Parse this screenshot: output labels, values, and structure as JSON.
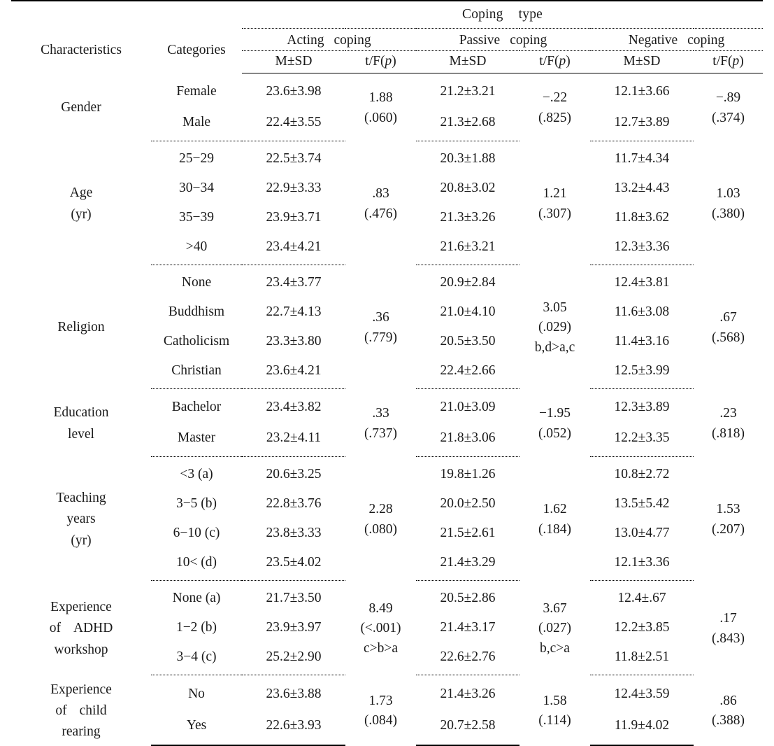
{
  "table": {
    "header": {
      "group_title": "Coping type",
      "stub_characteristics": "Characteristics",
      "stub_categories": "Categories",
      "groups": [
        {
          "name": "Acting coping",
          "word1": "Acting",
          "word2": "coping"
        },
        {
          "name": "Passive coping",
          "word1": "Passive",
          "word2": "coping"
        },
        {
          "name": "Negative coping",
          "word1": "Negative",
          "word2": "coping"
        }
      ],
      "sub_msd": "M±SD",
      "sub_tf_prefix": "t/F(",
      "sub_tf_italic": "p",
      "sub_tf_suffix": ")"
    },
    "sections": [
      {
        "characteristic": "Gender",
        "characteristic_lines": [
          "Gender"
        ],
        "categories": [
          "Female",
          "Male"
        ],
        "acting_msd": [
          "23.6±3.98",
          "22.4±3.55"
        ],
        "acting_tf": [
          "1.88",
          "(.060)"
        ],
        "passive_msd": [
          "21.2±3.21",
          "21.3±2.68"
        ],
        "passive_tf": [
          "−.22",
          "(.825)"
        ],
        "negative_msd": [
          "12.1±3.66",
          "12.7±3.89"
        ],
        "negative_tf": [
          "−.89",
          "(.374)"
        ]
      },
      {
        "characteristic": "Age (yr)",
        "characteristic_lines": [
          "Age",
          "(yr)"
        ],
        "categories": [
          "25−29",
          "30−34",
          "35−39",
          ">40"
        ],
        "acting_msd": [
          "22.5±3.74",
          "22.9±3.33",
          "23.9±3.71",
          "23.4±4.21"
        ],
        "acting_tf": [
          ".83",
          "(.476)"
        ],
        "passive_msd": [
          "20.3±1.88",
          "20.8±3.02",
          "21.3±3.26",
          "21.6±3.21"
        ],
        "passive_tf": [
          "1.21",
          "(.307)"
        ],
        "negative_msd": [
          "11.7±4.34",
          "13.2±4.43",
          "11.8±3.62",
          "12.3±3.36"
        ],
        "negative_tf": [
          "1.03",
          "(.380)"
        ]
      },
      {
        "characteristic": "Religion",
        "characteristic_lines": [
          "Religion"
        ],
        "categories": [
          "None",
          "Buddhism",
          "Catholicism",
          "Christian"
        ],
        "acting_msd": [
          "23.4±3.77",
          "22.7±4.13",
          "23.3±3.80",
          "23.6±4.21"
        ],
        "acting_tf": [
          ".36",
          "(.779)"
        ],
        "passive_msd": [
          "20.9±2.84",
          "21.0±4.10",
          "20.5±3.50",
          "22.4±2.66"
        ],
        "passive_tf": [
          "3.05",
          "(.029)",
          "b,d>a,c"
        ],
        "negative_msd": [
          "12.4±3.81",
          "11.6±3.08",
          "11.4±3.16",
          "12.5±3.99"
        ],
        "negative_tf": [
          ".67",
          "(.568)"
        ]
      },
      {
        "characteristic": "Education level",
        "characteristic_lines": [
          "Education",
          "level"
        ],
        "categories": [
          "Bachelor",
          "Master"
        ],
        "acting_msd": [
          "23.4±3.82",
          "23.2±4.11"
        ],
        "acting_tf": [
          ".33",
          "(.737)"
        ],
        "passive_msd": [
          "21.0±3.09",
          "21.8±3.06"
        ],
        "passive_tf": [
          "−1.95",
          "(.052)"
        ],
        "negative_msd": [
          "12.3±3.89",
          "12.2±3.35"
        ],
        "negative_tf": [
          ".23",
          "(.818)"
        ]
      },
      {
        "characteristic": "Teaching years (yr)",
        "characteristic_lines": [
          "Teaching",
          "years",
          "(yr)"
        ],
        "categories": [
          "<3 (a)",
          "3−5 (b)",
          "6−10 (c)",
          "10< (d)"
        ],
        "acting_msd": [
          "20.6±3.25",
          "22.8±3.76",
          "23.8±3.33",
          "23.5±4.02"
        ],
        "acting_tf": [
          "2.28",
          "(.080)"
        ],
        "passive_msd": [
          "19.8±1.26",
          "20.0±2.50",
          "21.5±2.61",
          "21.4±3.29"
        ],
        "passive_tf": [
          "1.62",
          "(.184)"
        ],
        "negative_msd": [
          "10.8±2.72",
          "13.5±5.42",
          "13.0±4.77",
          "12.1±3.36"
        ],
        "negative_tf": [
          "1.53",
          "(.207)"
        ]
      },
      {
        "characteristic": "Experience of ADHD workshop",
        "characteristic_lines": [
          "Experience",
          "of ADHD",
          "workshop"
        ],
        "categories": [
          "None (a)",
          "1−2 (b)",
          "3−4 (c)"
        ],
        "acting_msd": [
          "21.7±3.50",
          "23.9±3.97",
          "25.2±2.90"
        ],
        "acting_tf": [
          "8.49",
          "(<.001)",
          "c>b>a"
        ],
        "passive_msd": [
          "20.5±2.86",
          "21.4±3.17",
          "22.6±2.76"
        ],
        "passive_tf": [
          "3.67",
          "(.027)",
          "b,c>a"
        ],
        "negative_msd": [
          "12.4±.67",
          "12.2±3.85",
          "11.8±2.51"
        ],
        "negative_tf": [
          ".17",
          "(.843)"
        ]
      },
      {
        "characteristic": "Experience of child rearing",
        "characteristic_lines": [
          "Experience",
          "of child",
          "rearing"
        ],
        "categories": [
          "No",
          "Yes"
        ],
        "acting_msd": [
          "23.6±3.88",
          "22.6±3.93"
        ],
        "acting_tf": [
          "1.73",
          "(.084)"
        ],
        "passive_msd": [
          "21.4±3.26",
          "20.7±2.58"
        ],
        "passive_tf": [
          "1.58",
          "(.114)"
        ],
        "negative_msd": [
          "12.4±3.59",
          "11.9±4.02"
        ],
        "negative_tf": [
          ".86",
          "(.388)"
        ]
      }
    ]
  }
}
